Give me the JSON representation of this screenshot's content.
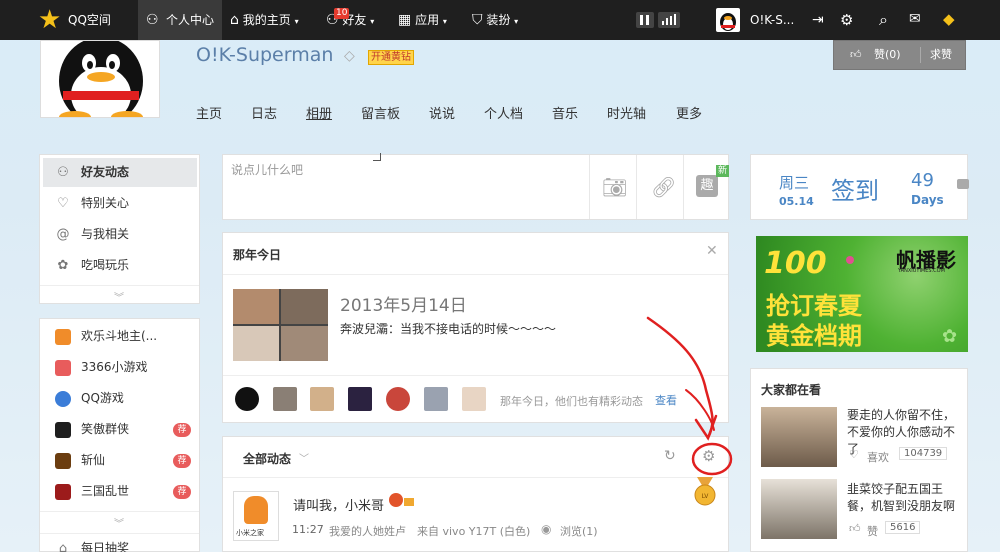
{
  "topbar": {
    "logo": "QQ空间",
    "nav": [
      {
        "label": "个人中心"
      },
      {
        "label": "我的主页"
      },
      {
        "label": "好友",
        "badge": "10"
      },
      {
        "label": "应用"
      },
      {
        "label": "装扮"
      }
    ],
    "user": "O!K-S..."
  },
  "profile": {
    "name": "O!K-Superman",
    "vip_label": "开通黄钻",
    "like_label": "赞(0)",
    "request_label": "求赞"
  },
  "mainnav": [
    "主页",
    "日志",
    "相册",
    "留言板",
    "说说",
    "个人档",
    "音乐",
    "时光轴",
    "更多"
  ],
  "sidebar": {
    "feeds": [
      {
        "label": "好友动态",
        "icon": "friend-icon"
      },
      {
        "label": "特别关心",
        "icon": "heart-icon"
      },
      {
        "label": "与我相关",
        "icon": "at-icon"
      },
      {
        "label": "吃喝玩乐",
        "icon": "fun-icon"
      }
    ],
    "games": [
      {
        "label": "欢乐斗地主(...",
        "color": "#f08c2a",
        "rec": ""
      },
      {
        "label": "3366小游戏",
        "color": "#e85c5c",
        "rec": ""
      },
      {
        "label": "QQ游戏",
        "color": "#3b7dd8",
        "rec": ""
      },
      {
        "label": "笑傲群侠",
        "color": "#1f1f1f",
        "rec": "荐"
      },
      {
        "label": "斩仙",
        "color": "#6b3d10",
        "rec": "荐"
      },
      {
        "label": "三国乱世",
        "color": "#9c1b1b",
        "rec": "荐"
      }
    ],
    "bottom": "每日抽奖"
  },
  "composer": {
    "placeholder": "说点儿什么吧",
    "new_badge": "新",
    "fun_label": "趣"
  },
  "memory": {
    "title": "那年今日",
    "date": "2013年5月14日",
    "text": "奔波兒灞：当我不接电话的时候～～～～",
    "footer": "那年今日，他们也有精彩动态",
    "view": "查看"
  },
  "feed": {
    "filter": "全部动态",
    "post": {
      "author": "请叫我，小米哥",
      "time": "11:27",
      "meta": "我爱的人她姓卢",
      "source": "来自 vivo Y17T (白色)",
      "views": "浏览(1)",
      "avatar_label": "小米之家"
    }
  },
  "checkin": {
    "weekday": "周三",
    "date": "05.14",
    "label": "签到",
    "days": "49",
    "days_label": "Days"
  },
  "ad": {
    "big": "100",
    "line1": "抢订春夏",
    "line2": "黄金档期",
    "brand": "帆播影",
    "url": "YANXIUTIMES.COM"
  },
  "trending": {
    "title": "大家都在看",
    "items": [
      {
        "text": "要走的人你留不住，不爱你的人你感动不了",
        "like": "喜欢",
        "count": "104739"
      },
      {
        "text": "韭菜饺子配五国王餐，机智到没朋友啊",
        "like": "赞",
        "count": "5616"
      }
    ]
  },
  "colors": {
    "topbar": "#1f1f1f",
    "accent_blue": "#4a86c5",
    "vip_gold": "#ffd44a",
    "ad_green": "#3a9c2e",
    "annotation_red": "#e02020"
  }
}
